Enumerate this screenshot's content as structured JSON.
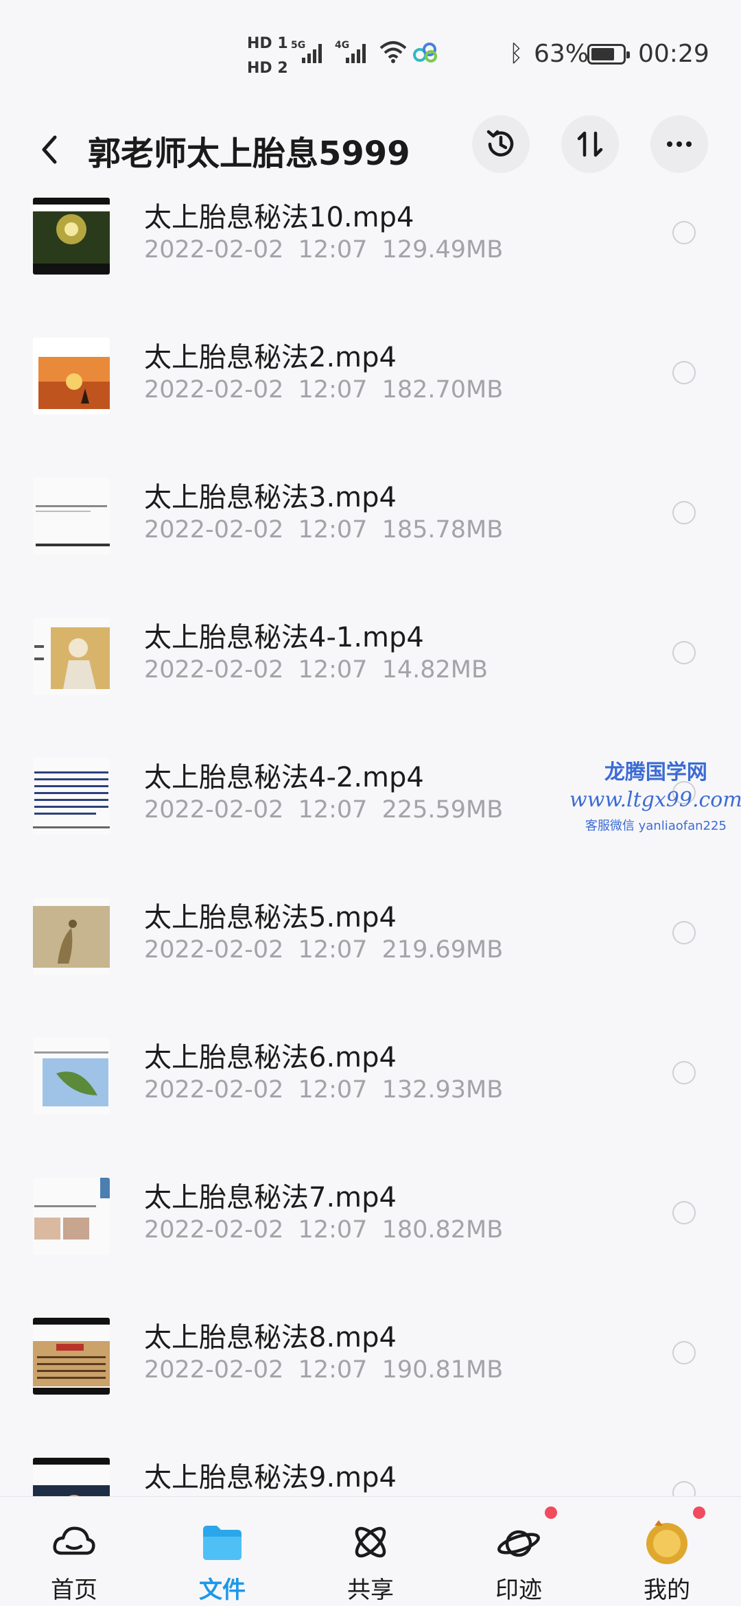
{
  "status_bar": {
    "hd1": "HD 1",
    "hd2": "HD 2",
    "net": "5G",
    "net2": "4G",
    "battery_percent": "63%",
    "time": "00:29"
  },
  "header": {
    "title": "郭老师太上胎息5999",
    "back_icon": "chevron-left-icon",
    "history_icon": "history-icon",
    "sort_icon": "sort-icon",
    "more_icon": "more-icon"
  },
  "files": [
    {
      "name": "太上胎息秘法10.mp4",
      "date": "2022-02-02",
      "time": "12:07",
      "size": "129.49MB",
      "thumb": "galaxy"
    },
    {
      "name": "太上胎息秘法2.mp4",
      "date": "2022-02-02",
      "time": "12:07",
      "size": "182.70MB",
      "thumb": "sunset"
    },
    {
      "name": "太上胎息秘法3.mp4",
      "date": "2022-02-02",
      "time": "12:07",
      "size": "185.78MB",
      "thumb": "text"
    },
    {
      "name": "太上胎息秘法4-1.mp4",
      "date": "2022-02-02",
      "time": "12:07",
      "size": "14.82MB",
      "thumb": "portrait"
    },
    {
      "name": "太上胎息秘法4-2.mp4",
      "date": "2022-02-02",
      "time": "12:07",
      "size": "225.59MB",
      "thumb": "document"
    },
    {
      "name": "太上胎息秘法5.mp4",
      "date": "2022-02-02",
      "time": "12:07",
      "size": "219.69MB",
      "thumb": "painting"
    },
    {
      "name": "太上胎息秘法6.mp4",
      "date": "2022-02-02",
      "time": "12:07",
      "size": "132.93MB",
      "thumb": "leaf"
    },
    {
      "name": "太上胎息秘法7.mp4",
      "date": "2022-02-02",
      "time": "12:07",
      "size": "180.82MB",
      "thumb": "slide"
    },
    {
      "name": "太上胎息秘法8.mp4",
      "date": "2022-02-02",
      "time": "12:07",
      "size": "190.81MB",
      "thumb": "chart"
    },
    {
      "name": "太上胎息秘法9.mp4",
      "date": "",
      "time": "",
      "size": "",
      "thumb": "dark"
    }
  ],
  "watermark": {
    "line1": "龙腾国学网",
    "line2": "www.ltgx99.com",
    "line3": "客服微信 yanliaofan225"
  },
  "bottom_nav": [
    {
      "label": "首页",
      "icon": "cloud-icon",
      "active": false
    },
    {
      "label": "文件",
      "icon": "folder-icon",
      "active": true
    },
    {
      "label": "共享",
      "icon": "share-icon",
      "active": false
    },
    {
      "label": "印迹",
      "icon": "planet-icon",
      "active": false
    },
    {
      "label": "我的",
      "icon": "avatar",
      "active": false
    }
  ],
  "colors": {
    "accent": "#1e98e8",
    "badge": "#f04b5e",
    "meta_text": "#a3a3a8",
    "background": "#f7f7f9"
  }
}
